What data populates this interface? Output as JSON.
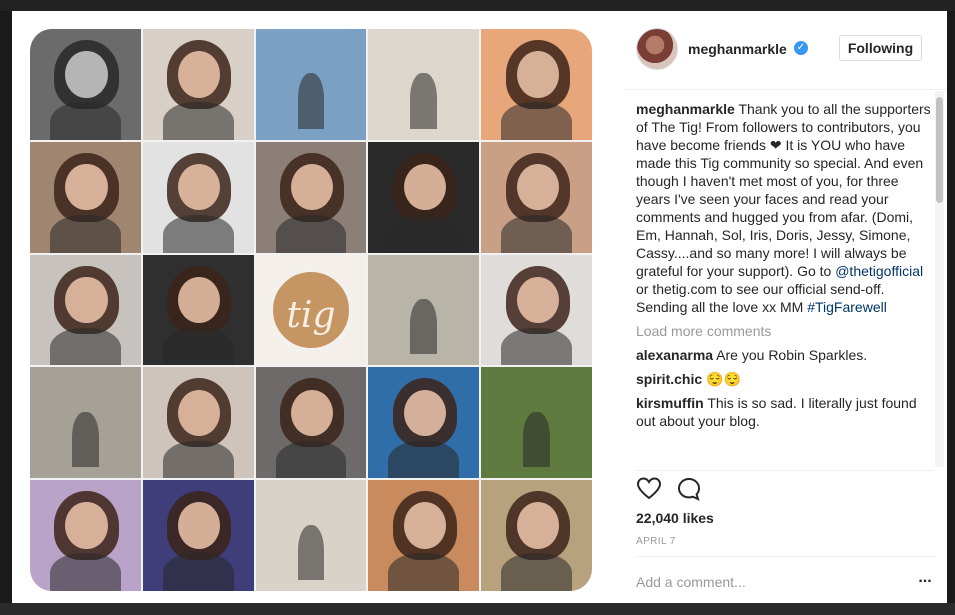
{
  "post": {
    "username": "meghanmarkle",
    "verified": true,
    "follow_label": "Following",
    "tiles": [
      {
        "kind": "portrait",
        "bg": "#6b6b6b",
        "bw": true
      },
      {
        "kind": "portrait",
        "bg": "#d8cfc6"
      },
      {
        "kind": "scene",
        "bg": "#7aa0c4"
      },
      {
        "kind": "scene",
        "bg": "#ddd6cc"
      },
      {
        "kind": "portrait",
        "bg": "#e8a77b"
      },
      {
        "kind": "portrait",
        "bg": "#a08570"
      },
      {
        "kind": "portrait",
        "bg": "#e2e2e2"
      },
      {
        "kind": "portrait",
        "bg": "#8b7f78"
      },
      {
        "kind": "portrait",
        "bg": "#2a2a2a"
      },
      {
        "kind": "portrait",
        "bg": "#c9a086"
      },
      {
        "kind": "portrait",
        "bg": "#c7c2be"
      },
      {
        "kind": "portrait",
        "bg": "#2f2f2f"
      },
      {
        "kind": "latte",
        "bg": "#f4efe9"
      },
      {
        "kind": "scene",
        "bg": "#b9b4a8"
      },
      {
        "kind": "portrait",
        "bg": "#e0dcd9"
      },
      {
        "kind": "scene",
        "bg": "#a6a196"
      },
      {
        "kind": "portrait",
        "bg": "#cfc4bb"
      },
      {
        "kind": "portrait",
        "bg": "#6e6a6a"
      },
      {
        "kind": "portrait",
        "bg": "#2f6ea8"
      },
      {
        "kind": "scene",
        "bg": "#5f7a3f"
      },
      {
        "kind": "portrait",
        "bg": "#b9a3c8"
      },
      {
        "kind": "portrait",
        "bg": "#3f3d7a"
      },
      {
        "kind": "scene",
        "bg": "#d9d2c8"
      },
      {
        "kind": "portrait",
        "bg": "#c98a5e"
      },
      {
        "kind": "portrait",
        "bg": "#b8a27e"
      }
    ],
    "latte_text": "tig"
  },
  "caption": {
    "username": "meghanmarkle",
    "text_1": " Thank you to all the supporters of The Tig! From followers to contributors, you have become friends ❤ It is YOU who have made this Tig community so special. And even though I haven't met most of you, for three years I've seen your faces and read your comments and hugged you from afar. (Domi, Em, Hannah, Sol, Iris, Doris, Jessy, Simone, Cassy....and so many more! I will always be grateful for your support). Go to ",
    "mention": "@thetigofficial",
    "text_2": " or thetig.com to see our official send-off. Sending all the love xx MM ",
    "hashtag": "#TigFarewell"
  },
  "load_more_label": "Load more comments",
  "comments": [
    {
      "username": "alexanarma",
      "text": " Are you Robin Sparkles."
    },
    {
      "username": "spirit.chic",
      "text": " 😌😌"
    },
    {
      "username": "kirsmuffin",
      "text": " This is so sad. I literally just found out about your blog."
    }
  ],
  "likes_text": "22,040 likes",
  "date_text": "APRIL 7",
  "comment_placeholder": "Add a comment...",
  "more_label": "...",
  "icons": {
    "like": "heart-icon",
    "comment": "comment-bubble-icon",
    "more": "more-options-icon",
    "verified": "verified-badge-icon"
  },
  "colors": {
    "link": "#003569",
    "verified": "#3897f0",
    "muted": "#999999",
    "text": "#262626"
  }
}
